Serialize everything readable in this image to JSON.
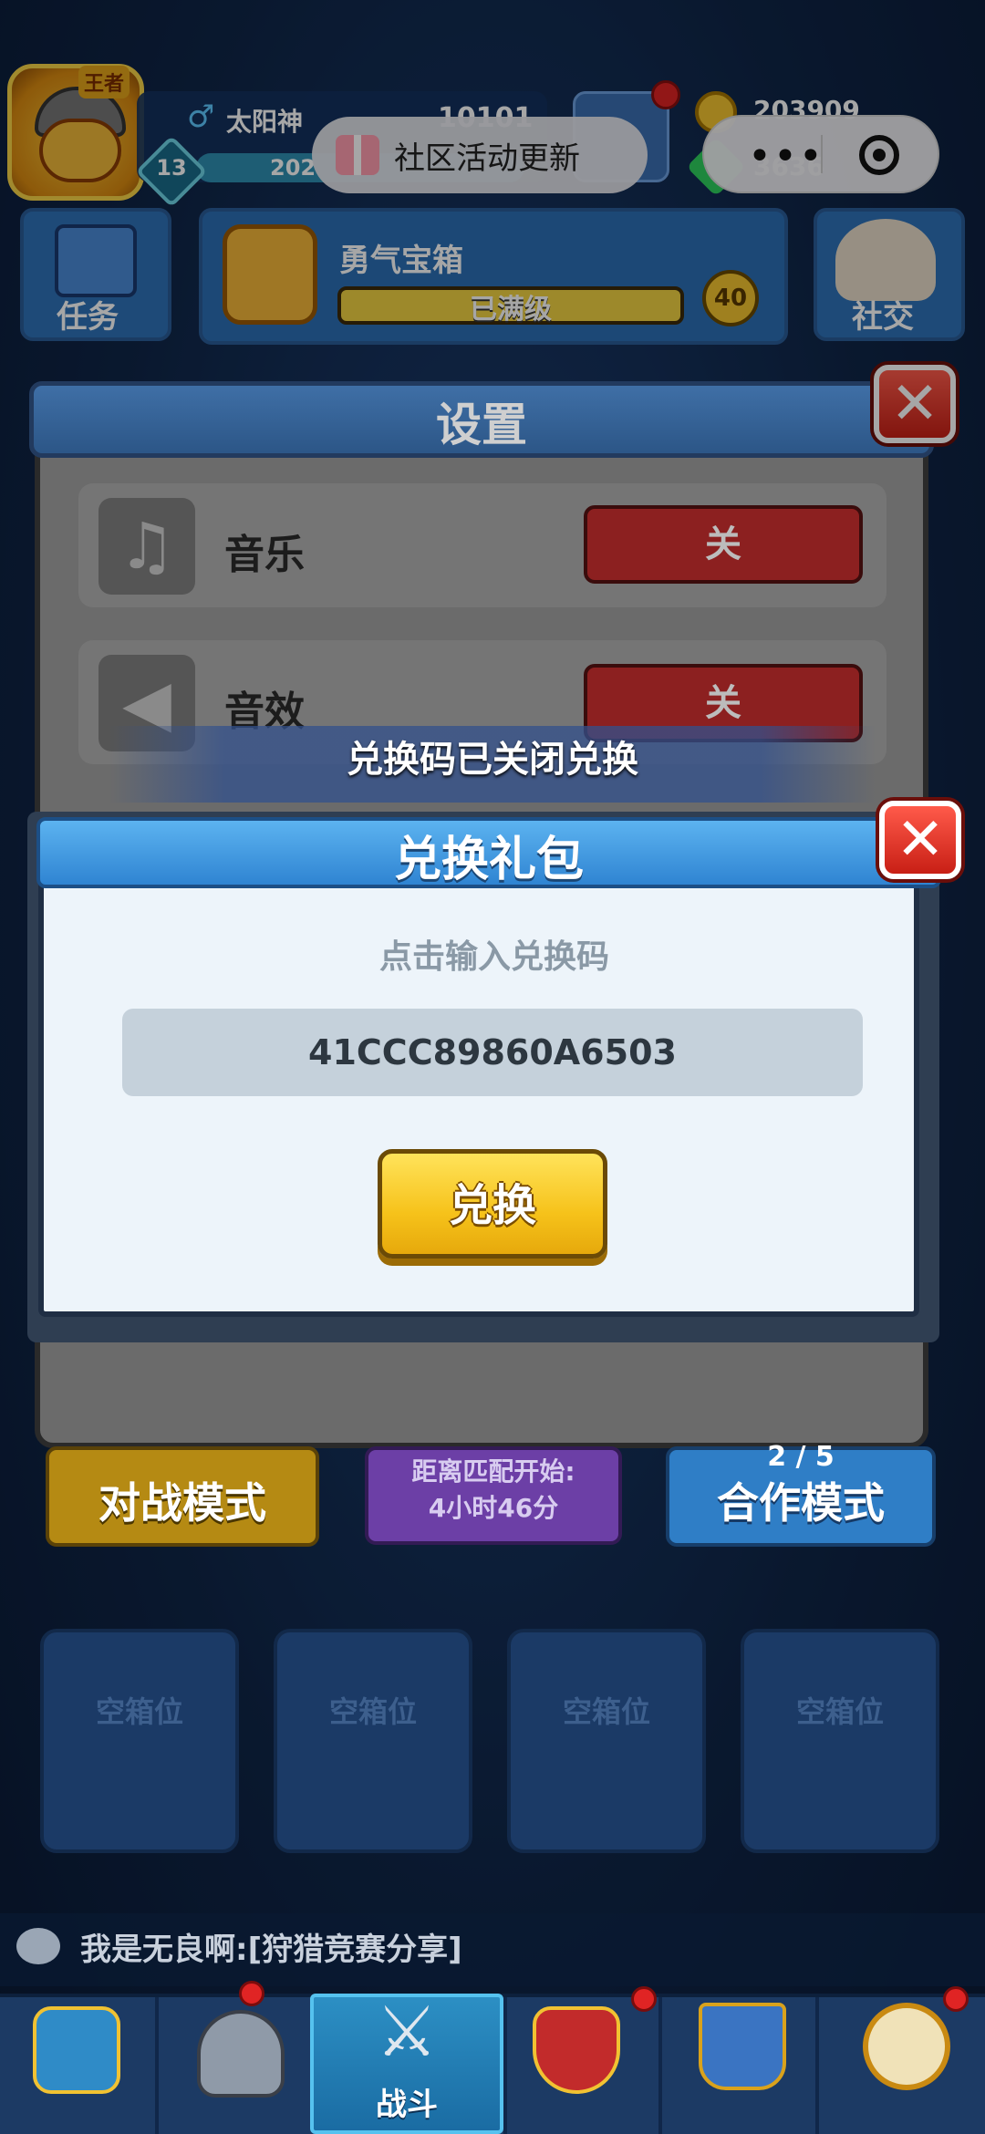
{
  "hud": {
    "player_name": "太阳神",
    "rank_tag": "王者",
    "level": "13",
    "xp_text": "202",
    "trophies": "10101",
    "coins": "203909",
    "gems": "3636"
  },
  "capsule": {
    "event_label": "社区活动更新"
  },
  "top_row": {
    "task_label": "任务",
    "chest_title": "勇气宝箱",
    "chest_status": "已满级",
    "chest_count": "40",
    "social_label": "社交"
  },
  "settings": {
    "title": "设置",
    "rows": [
      {
        "label": "音乐",
        "state": "关",
        "icon": "music-note-icon"
      },
      {
        "label": "音效",
        "state": "关",
        "icon": "speaker-icon"
      }
    ]
  },
  "toast": {
    "message": "兑换码已关闭兑换"
  },
  "gift_dialog": {
    "title": "兑换礼包",
    "hint": "点击输入兑换码",
    "code": "41CCC89860A6503",
    "redeem_label": "兑换"
  },
  "modes": {
    "pvp_label": "对战模式",
    "match_line1": "距离匹配开始:",
    "match_line2": "4小时46分",
    "coop_count": "2 / 5",
    "coop_label": "合作模式"
  },
  "slots": [
    "空箱位",
    "空箱位",
    "空箱位",
    "空箱位"
  ],
  "chat": {
    "message": "我是无良啊:[狩猎竞赛分享]"
  },
  "bottom_nav": {
    "active_label": "战斗",
    "items": [
      "treasure-chest-icon",
      "knight-helmet-icon",
      "crossed-swords-icon",
      "clan-shield-icon",
      "friends-banner-icon",
      "compass-icon"
    ]
  },
  "colors": {
    "alert_red": "#e02424",
    "redeem_gold": "#f6c21a",
    "dialog_blue": "#2f84d2"
  }
}
